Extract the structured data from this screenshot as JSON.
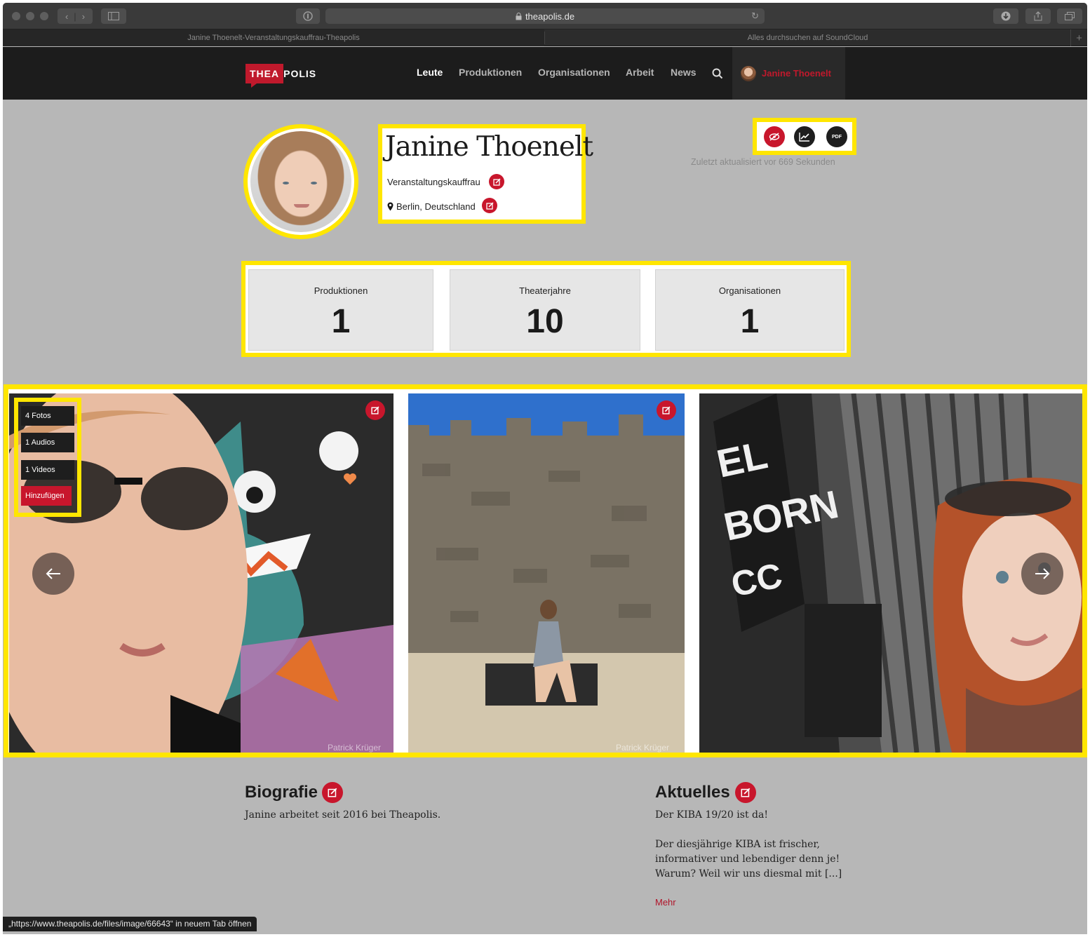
{
  "browser": {
    "url": "theapolis.de",
    "tabs": [
      {
        "title": "Janine Thoenelt-Veranstaltungskauffrau-Theapolis"
      },
      {
        "title": "Alles durchsuchen auf SoundCloud"
      }
    ],
    "status_bar_text": "„https://www.theapolis.de/files/image/66643“ in neuem Tab öffnen"
  },
  "site": {
    "logo_left": "THEA",
    "logo_right": "POLIS",
    "nav": [
      "Leute",
      "Produktionen",
      "Organisationen",
      "Arbeit",
      "News"
    ],
    "active_nav": "Leute",
    "user_name": "Janine Thoenelt"
  },
  "profile": {
    "name": "Janine Thoenelt",
    "role": "Veranstaltungskauffrau",
    "location": "Berlin, Deutschland",
    "pdf_label": "PDF",
    "updated": "Zuletzt aktualisiert vor 669 Sekunden"
  },
  "stats": [
    {
      "label": "Produktionen",
      "value": "1"
    },
    {
      "label": "Theaterjahre",
      "value": "10"
    },
    {
      "label": "Organisationen",
      "value": "1"
    }
  ],
  "media_menu": {
    "photos": "4 Fotos",
    "audios": "1 Audios",
    "videos": "1 Videos",
    "add": "Hinzufügen"
  },
  "gallery": {
    "credits": [
      "Patrick Krüger",
      "Patrick Krüger"
    ]
  },
  "bio": {
    "title": "Biografie",
    "text": "Janine arbeitet seit 2016 bei Theapolis."
  },
  "news": {
    "title": "Aktuelles",
    "headline": "Der KIBA 19/20 ist da!",
    "line1": "Der diesjährige KIBA ist frischer,",
    "line2": "informativer und lebendiger denn je!",
    "line3": "Warum? Weil wir uns diesmal mit [...]",
    "more": "Mehr"
  },
  "colors": {
    "accent": "#c8162c",
    "highlight": "#ffe600",
    "nav_bg": "#1c1c1c",
    "page_bg": "#b7b7b7"
  }
}
